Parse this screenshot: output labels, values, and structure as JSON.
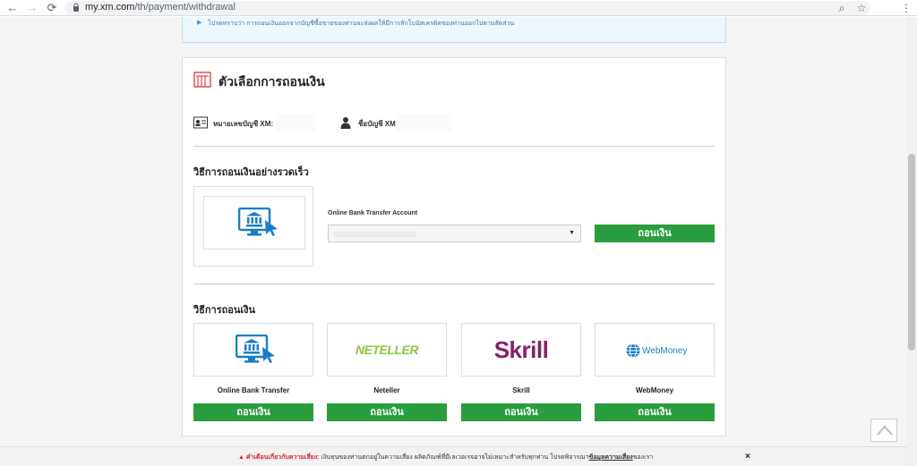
{
  "browser": {
    "url_host": "my.xm.com",
    "url_path": "/th/payment/withdrawal",
    "back_icon": "←",
    "forward_icon": "→",
    "reload_icon": "⟳",
    "zoom_icon": "⌕",
    "star_icon": "☆",
    "menu_icon": "⋮"
  },
  "notice": {
    "text": "โปรดทราบว่า การถอนเงินออกจากบัญชีซื้อขายของท่านจะส่งผลให้มีการหักโบนัสเครดิตของท่านออกไปตามสัดส่วน"
  },
  "panel": {
    "title": "ตัวเลือกการถอนเงิน",
    "account_number_label": "หมายเลขบัญชี XM:",
    "account_name_label": "ชื่อบัญชี XM:"
  },
  "quick": {
    "section_title": "วิธีการถอนเงินอย่างรวดเร็ว",
    "field_label": "Online Bank Transfer Account",
    "button_label": "ถอนเงิน"
  },
  "methods": {
    "section_title": "วิธีการถอนเงิน",
    "items": [
      {
        "name": "Online Bank Transfer",
        "button_label": "ถอนเงิน"
      },
      {
        "name": "Neteller",
        "logo_text": "NETELLER",
        "button_label": "ถอนเงิน"
      },
      {
        "name": "Skrill",
        "logo_text": "Skrill",
        "button_label": "ถอนเงิน"
      },
      {
        "name": "WebMoney",
        "logo_text": "WebMoney",
        "button_label": "ถอนเงิน"
      }
    ]
  },
  "risk_bar": {
    "warning_label": "คำเตือนเกี่ยวกับความเสี่ยง:",
    "text_before_link": " เงินทุนของท่านตกอยู่ในความเสี่ยง ผลิตภัณฑ์ที่มีเลเวอเรจอาจไม่เหมาะสำหรับทุกท่าน โปรดพิจารณา",
    "link_text": "ข้อมูลความเสี่ยง",
    "text_after_link": "ของเรา",
    "close_label": "×"
  },
  "colors": {
    "accent_green": "#2a9d3e",
    "bank_blue": "#1a7ec4",
    "neteller_green": "#8dc63f",
    "skrill_purple": "#862165",
    "warning_red": "#d8262d"
  }
}
